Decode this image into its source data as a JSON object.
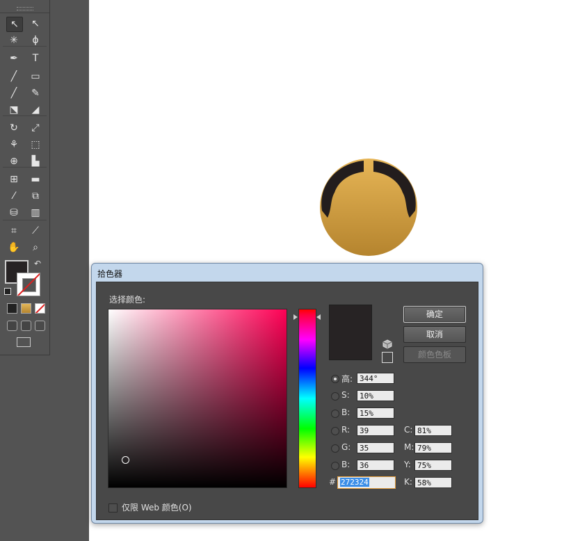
{
  "toolbar": {
    "tools": [
      {
        "name": "selection-tool",
        "glyph": "↖"
      },
      {
        "name": "direct-selection-tool",
        "glyph": "↖"
      },
      {
        "name": "magic-wand-tool",
        "glyph": "✳"
      },
      {
        "name": "lasso-tool",
        "glyph": "ϕ"
      },
      {
        "name": "pen-tool",
        "glyph": "✒"
      },
      {
        "name": "type-tool",
        "glyph": "T"
      },
      {
        "name": "line-tool",
        "glyph": "╱"
      },
      {
        "name": "rectangle-tool",
        "glyph": "▭"
      },
      {
        "name": "paintbrush-tool",
        "glyph": "╱"
      },
      {
        "name": "pencil-tool",
        "glyph": "✎"
      },
      {
        "name": "blob-brush-tool",
        "glyph": "⬔"
      },
      {
        "name": "eraser-tool",
        "glyph": "◢"
      },
      {
        "name": "rotate-tool",
        "glyph": "↻"
      },
      {
        "name": "scale-tool",
        "glyph": "⤢"
      },
      {
        "name": "warp-tool",
        "glyph": "⚘"
      },
      {
        "name": "free-transform-tool",
        "glyph": "⬚"
      },
      {
        "name": "shape-builder-tool",
        "glyph": "⊕"
      },
      {
        "name": "perspective-grid-tool",
        "glyph": "▙"
      },
      {
        "name": "mesh-tool",
        "glyph": "⊞"
      },
      {
        "name": "gradient-tool",
        "glyph": "▬"
      },
      {
        "name": "eyedropper-tool",
        "glyph": "⁄"
      },
      {
        "name": "blend-tool",
        "glyph": "⧉"
      },
      {
        "name": "symbol-sprayer-tool",
        "glyph": "⛁"
      },
      {
        "name": "column-graph-tool",
        "glyph": "▥"
      },
      {
        "name": "artboard-tool",
        "glyph": "⌗"
      },
      {
        "name": "slice-tool",
        "glyph": "⟋"
      },
      {
        "name": "hand-tool",
        "glyph": "✋"
      },
      {
        "name": "zoom-tool",
        "glyph": "⌕"
      }
    ],
    "fill_color": "#272324"
  },
  "dialog": {
    "title": "拾色器",
    "select_color_label": "选择颜色:",
    "ok_label": "确定",
    "cancel_label": "取消",
    "swatches_label": "颜色色板",
    "web_only_label": "仅限 Web 颜色(O)",
    "hsb": [
      {
        "label": "高:",
        "value": "344°",
        "selected": true
      },
      {
        "label": "S:",
        "value": "10%"
      },
      {
        "label": "B:",
        "value": "15%"
      }
    ],
    "rgb": [
      {
        "label": "R:",
        "value": "39"
      },
      {
        "label": "G:",
        "value": "35"
      },
      {
        "label": "B:",
        "value": "36"
      }
    ],
    "cmyk": [
      {
        "label": "C:",
        "value": "81%"
      },
      {
        "label": "M:",
        "value": "79%"
      },
      {
        "label": "Y:",
        "value": "75%"
      },
      {
        "label": "K:",
        "value": "58%"
      }
    ],
    "hex_prefix": "#",
    "hex_value": "272324",
    "current_color": "#272324"
  }
}
